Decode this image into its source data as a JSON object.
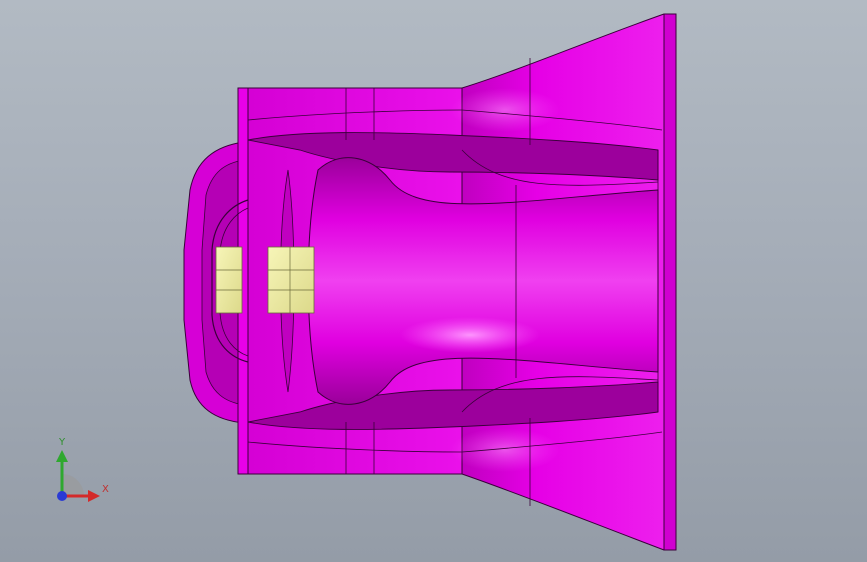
{
  "viewport": {
    "background_top": "#b2bac3",
    "background_bottom": "#949ca7"
  },
  "model": {
    "body_color": "#e600e6",
    "shade_color": "#a000a0",
    "highlight_color": "#ff66ff",
    "insert_color": "#f2f0a0",
    "edge_color": "#3a003a"
  },
  "triad": {
    "x_label": "X",
    "y_label": "Y",
    "x_color": "#d42a2a",
    "y_color": "#2fa82f",
    "z_color": "#2a3ad4",
    "icons": [
      "triad-x-arrow-icon",
      "triad-y-arrow-icon",
      "triad-z-dot-icon"
    ]
  }
}
